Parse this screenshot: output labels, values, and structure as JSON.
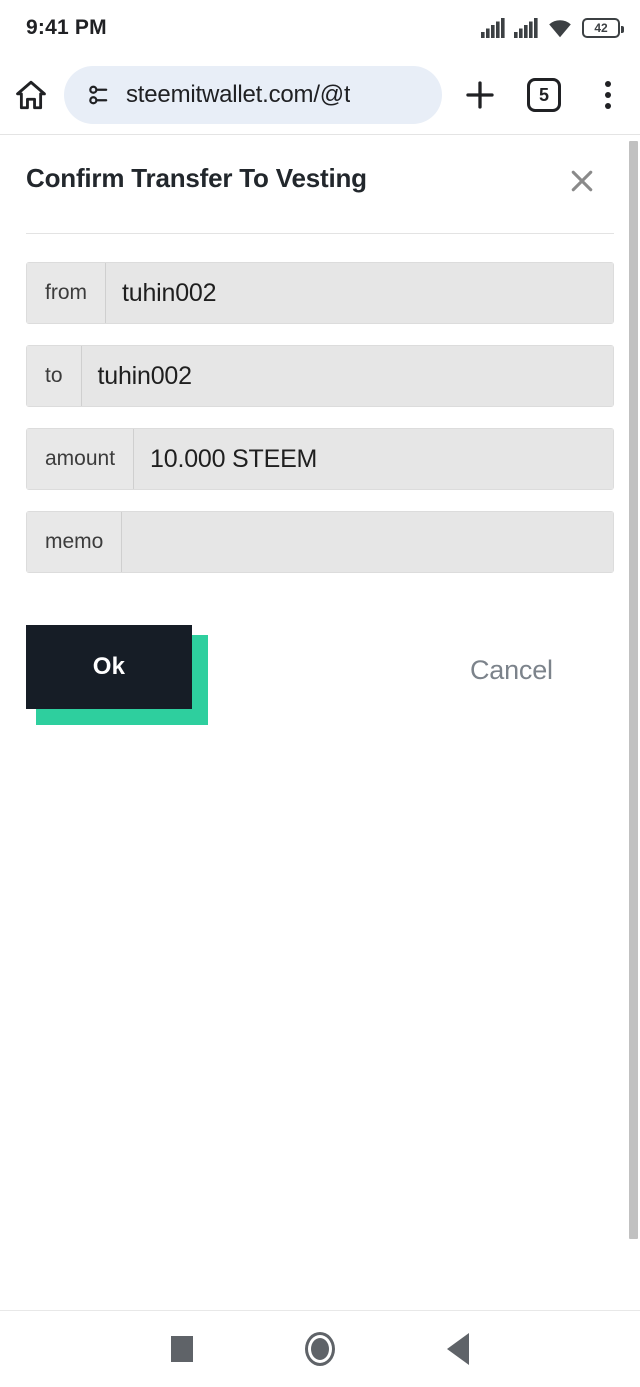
{
  "status_bar": {
    "time": "9:41 PM",
    "battery_level": "42",
    "icons": [
      "signal-bars-sim1-icon",
      "signal-bars-sim2-icon",
      "wifi-icon",
      "battery-icon"
    ]
  },
  "browser_toolbar": {
    "home_icon": "home-icon",
    "site_settings_icon": "tune-icon",
    "url": "steemitwallet.com/@t",
    "new_tab_icon": "plus-icon",
    "tab_count": "5",
    "menu_icon": "three-dot-menu-icon"
  },
  "dialog": {
    "title": "Confirm Transfer To Vesting",
    "close_icon": "close-icon",
    "fields": [
      {
        "label": "from",
        "value": "tuhin002"
      },
      {
        "label": "to",
        "value": "tuhin002"
      },
      {
        "label": "amount",
        "value": "10.000 STEEM"
      },
      {
        "label": "memo",
        "value": ""
      }
    ],
    "confirm_label": "Ok",
    "cancel_label": "Cancel",
    "colors": {
      "confirm_bg": "#161d26",
      "confirm_shadow": "#2ecf9e",
      "cancel_text": "#7c838b",
      "field_bg": "#e8e8e8"
    }
  },
  "nav_bar": {
    "recents_icon": "square-recents-icon",
    "home_icon": "circle-home-icon",
    "back_icon": "triangle-back-icon"
  }
}
